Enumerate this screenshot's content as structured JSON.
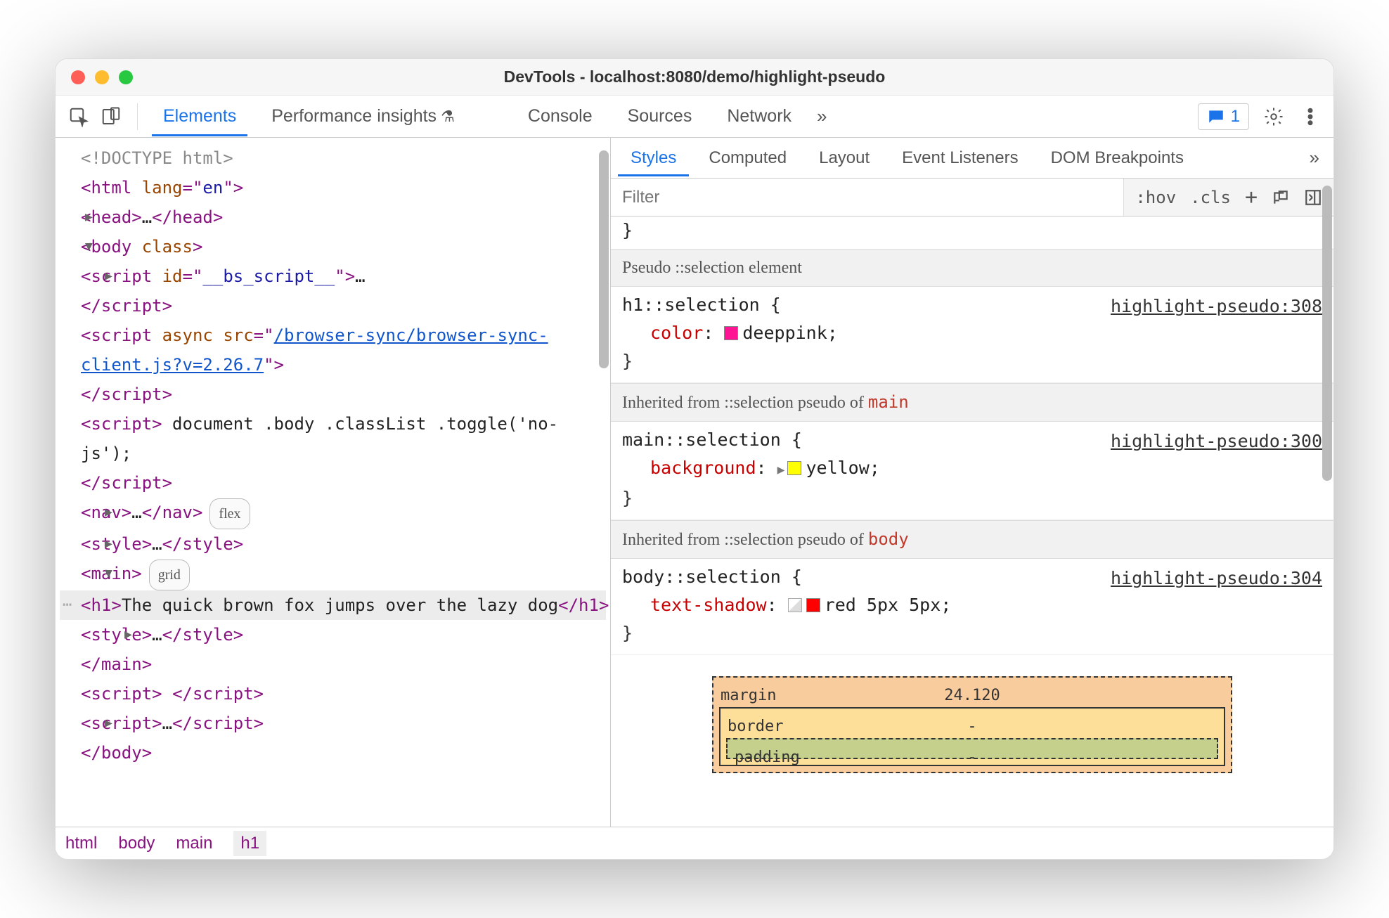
{
  "window": {
    "title": "DevTools - localhost:8080/demo/highlight-pseudo"
  },
  "toolbar": {
    "tabs": [
      "Elements",
      "Performance insights",
      "Console",
      "Sources",
      "Network"
    ],
    "active_tab": 0,
    "message_count": "1"
  },
  "dom": {
    "lines": [
      {
        "indent": 1,
        "raw": "<!DOCTYPE html>",
        "type": "doctype"
      },
      {
        "indent": 1,
        "open": "html",
        "attrs": [
          [
            "lang",
            "en"
          ]
        ]
      },
      {
        "indent": 2,
        "arrow": "right",
        "open": "head",
        "ell": true,
        "close": "head"
      },
      {
        "indent": 2,
        "arrow": "down",
        "open": "body",
        "attrs": [
          [
            "class",
            ""
          ]
        ]
      },
      {
        "indent": 3,
        "arrow": "right",
        "open": "script",
        "attrs": [
          [
            "id",
            "__bs_script__"
          ]
        ],
        "ell": true
      },
      {
        "indent": 3,
        "close": "script"
      },
      {
        "indent": 3,
        "open": "script",
        "attrs": [
          [
            "async",
            ""
          ]
        ],
        "link_attr": [
          "src",
          "/browser-sync/browser-sync-client.js?v=2.26.7"
        ],
        "wrap": true
      },
      {
        "indent": 3,
        "close": "script"
      },
      {
        "indent": 3,
        "open": "script",
        "text": " document .body .classList .toggle('no-js');",
        "wrap": true
      },
      {
        "indent": 3,
        "close": "script"
      },
      {
        "indent": 3,
        "arrow": "right",
        "open": "nav",
        "ell": true,
        "close": "nav",
        "badge": "flex"
      },
      {
        "indent": 3,
        "arrow": "right",
        "open": "style",
        "ell": true,
        "close": "style"
      },
      {
        "indent": 3,
        "arrow": "down",
        "open": "main",
        "badge": "grid"
      },
      {
        "indent": 4,
        "open": "h1",
        "text": "The quick brown fox jumps over the lazy dog",
        "close": "h1",
        "selected": true,
        "eqdollar": true
      },
      {
        "indent": 4,
        "arrow": "right",
        "open": "style",
        "ell": true,
        "close": "style"
      },
      {
        "indent": 3,
        "close": "main"
      },
      {
        "indent": 3,
        "open": "script",
        "text": " ",
        "close": "script"
      },
      {
        "indent": 3,
        "arrow": "right",
        "open": "script",
        "ell": true,
        "close": "script"
      },
      {
        "indent": 2,
        "close": "body"
      }
    ]
  },
  "breadcrumbs": [
    "html",
    "body",
    "main",
    "h1"
  ],
  "styles_tabs": [
    "Styles",
    "Computed",
    "Layout",
    "Event Listeners",
    "DOM Breakpoints"
  ],
  "styles_active": 0,
  "filter": {
    "placeholder": "Filter",
    "hov": ":hov",
    "cls": ".cls"
  },
  "peek_brace": "}",
  "sections": [
    {
      "header": "Pseudo ::selection element",
      "rule": {
        "selector": "h1::selection",
        "src": "highlight-pseudo:308",
        "decls": [
          {
            "prop": "color",
            "swatch": "#ff1493",
            "value": "deeppink"
          }
        ]
      }
    },
    {
      "header": "Inherited from ::selection pseudo of ",
      "header_code": "main",
      "rule": {
        "selector": "main::selection",
        "src": "highlight-pseudo:300",
        "decls": [
          {
            "prop": "background",
            "expand": true,
            "swatch": "#ffff00",
            "value": "yellow"
          }
        ]
      }
    },
    {
      "header": "Inherited from ::selection pseudo of ",
      "header_code": "body",
      "rule": {
        "selector": "body::selection",
        "src": "highlight-pseudo:304",
        "decls": [
          {
            "prop": "text-shadow",
            "shadowicon": true,
            "swatch": "#ff0000",
            "value": "red 5px 5px"
          }
        ]
      }
    }
  ],
  "boxmodel": {
    "margin_label": "margin",
    "margin_value": "24.120",
    "border_label": "border",
    "border_value": "-",
    "padding_label": "padding",
    "padding_value": "-"
  }
}
